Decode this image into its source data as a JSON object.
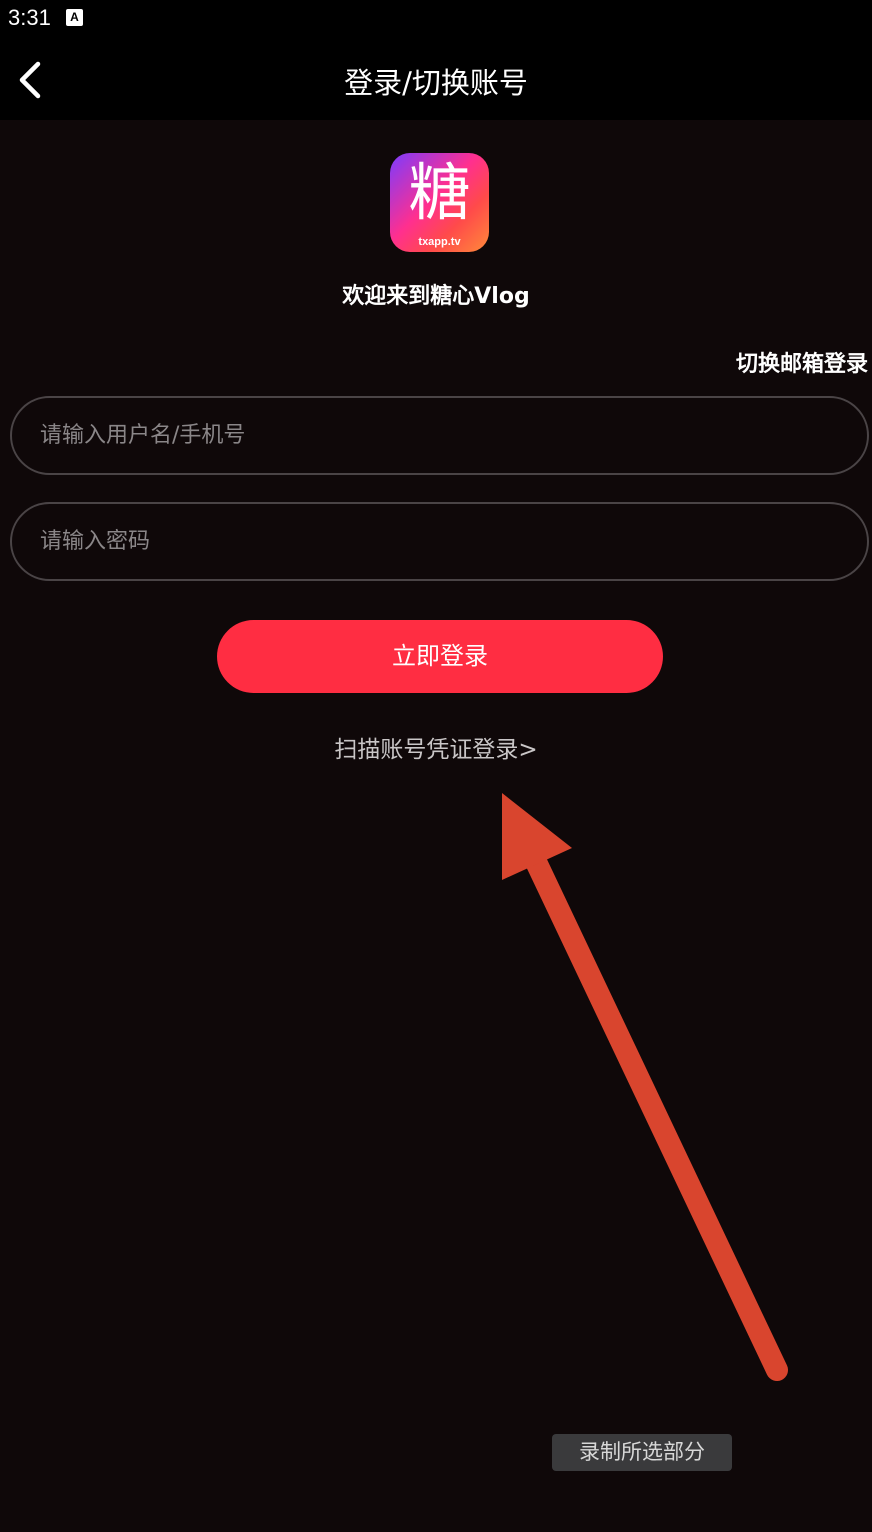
{
  "status_bar": {
    "time": "3:31",
    "notification_icon": "a-icon"
  },
  "header": {
    "back_icon": "chevron-left-icon",
    "title": "登录/切换账号"
  },
  "app": {
    "logo_char": "糖",
    "logo_sub": "txapp.tv",
    "welcome": "欢迎来到糖心Vlog"
  },
  "form": {
    "switch_email_label": "切换邮箱登录",
    "username_placeholder": "请输入用户名/手机号",
    "username_value": "",
    "password_placeholder": "请输入密码",
    "password_value": "",
    "login_button": "立即登录",
    "scan_link": "扫描账号凭证登录>"
  },
  "overlay": {
    "annotation": "arrow pointing to scan link",
    "record_badge": "录制所选部分"
  },
  "colors": {
    "background": "#0f0809",
    "accent": "#ff2d42",
    "arrow": "#d9452e"
  }
}
